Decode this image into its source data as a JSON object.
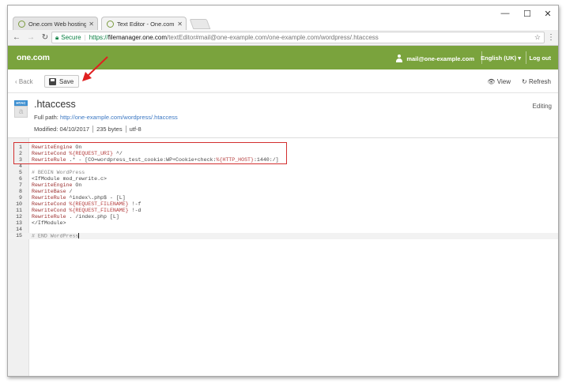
{
  "browser": {
    "tabs": [
      {
        "label": "One.com Web hosting - ",
        "active": false
      },
      {
        "label": "Text Editor - One.com Fi",
        "active": true
      }
    ],
    "window_controls": {
      "minimize": "—",
      "maximize": "☐",
      "close": "✕"
    },
    "address": {
      "secure_label": "Secure",
      "url_proto": "https://",
      "url_host": "filemanager.one.com",
      "url_path": "/textEditor#mail@one-example.com/one-example.com/wordpress/.htaccess"
    }
  },
  "header": {
    "logo": "one.com",
    "account": "mail@one-example.com",
    "language": "English (UK) ▾",
    "logout": "Log out",
    "brand_color": "#7aa33d"
  },
  "actions": {
    "back": "Back",
    "save": "Save",
    "view": "View",
    "refresh": "Refresh"
  },
  "file": {
    "icon_tag": "HTAC",
    "icon_letter": "a",
    "name": ".htaccess",
    "status": "Editing",
    "full_path_label": "Full path:",
    "full_path": "http://one-example.com/wordpress/.htaccess",
    "modified_label": "Modified:",
    "modified": "04/10/2017",
    "size": "235 bytes",
    "encoding": "utf-8"
  },
  "editor": {
    "lines": [
      {
        "n": "1",
        "text": "RewriteEngine On"
      },
      {
        "n": "2",
        "text": "RewriteCond %{REQUEST_URI} ^/"
      },
      {
        "n": "3",
        "text": "RewriteRule .* - [CO=wordpress_test_cookie:WP+Cookie+check:%{HTTP_HOST}:1440:/]"
      },
      {
        "n": "4",
        "text": ""
      },
      {
        "n": "5",
        "text": "# BEGIN WordPress"
      },
      {
        "n": "6",
        "text": "<IfModule mod_rewrite.c>"
      },
      {
        "n": "7",
        "text": "RewriteEngine On"
      },
      {
        "n": "8",
        "text": "RewriteBase /"
      },
      {
        "n": "9",
        "text": "RewriteRule ^index\\.php$ - [L]"
      },
      {
        "n": "10",
        "text": "RewriteCond %{REQUEST_FILENAME} !-f"
      },
      {
        "n": "11",
        "text": "RewriteCond %{REQUEST_FILENAME} !-d"
      },
      {
        "n": "12",
        "text": "RewriteRule . /index.php [L]"
      },
      {
        "n": "13",
        "text": "</IfModule>"
      },
      {
        "n": "14",
        "text": ""
      },
      {
        "n": "15",
        "text": "# END WordPress"
      }
    ],
    "active_line": 15,
    "highlight_color": "#d32f2f"
  }
}
